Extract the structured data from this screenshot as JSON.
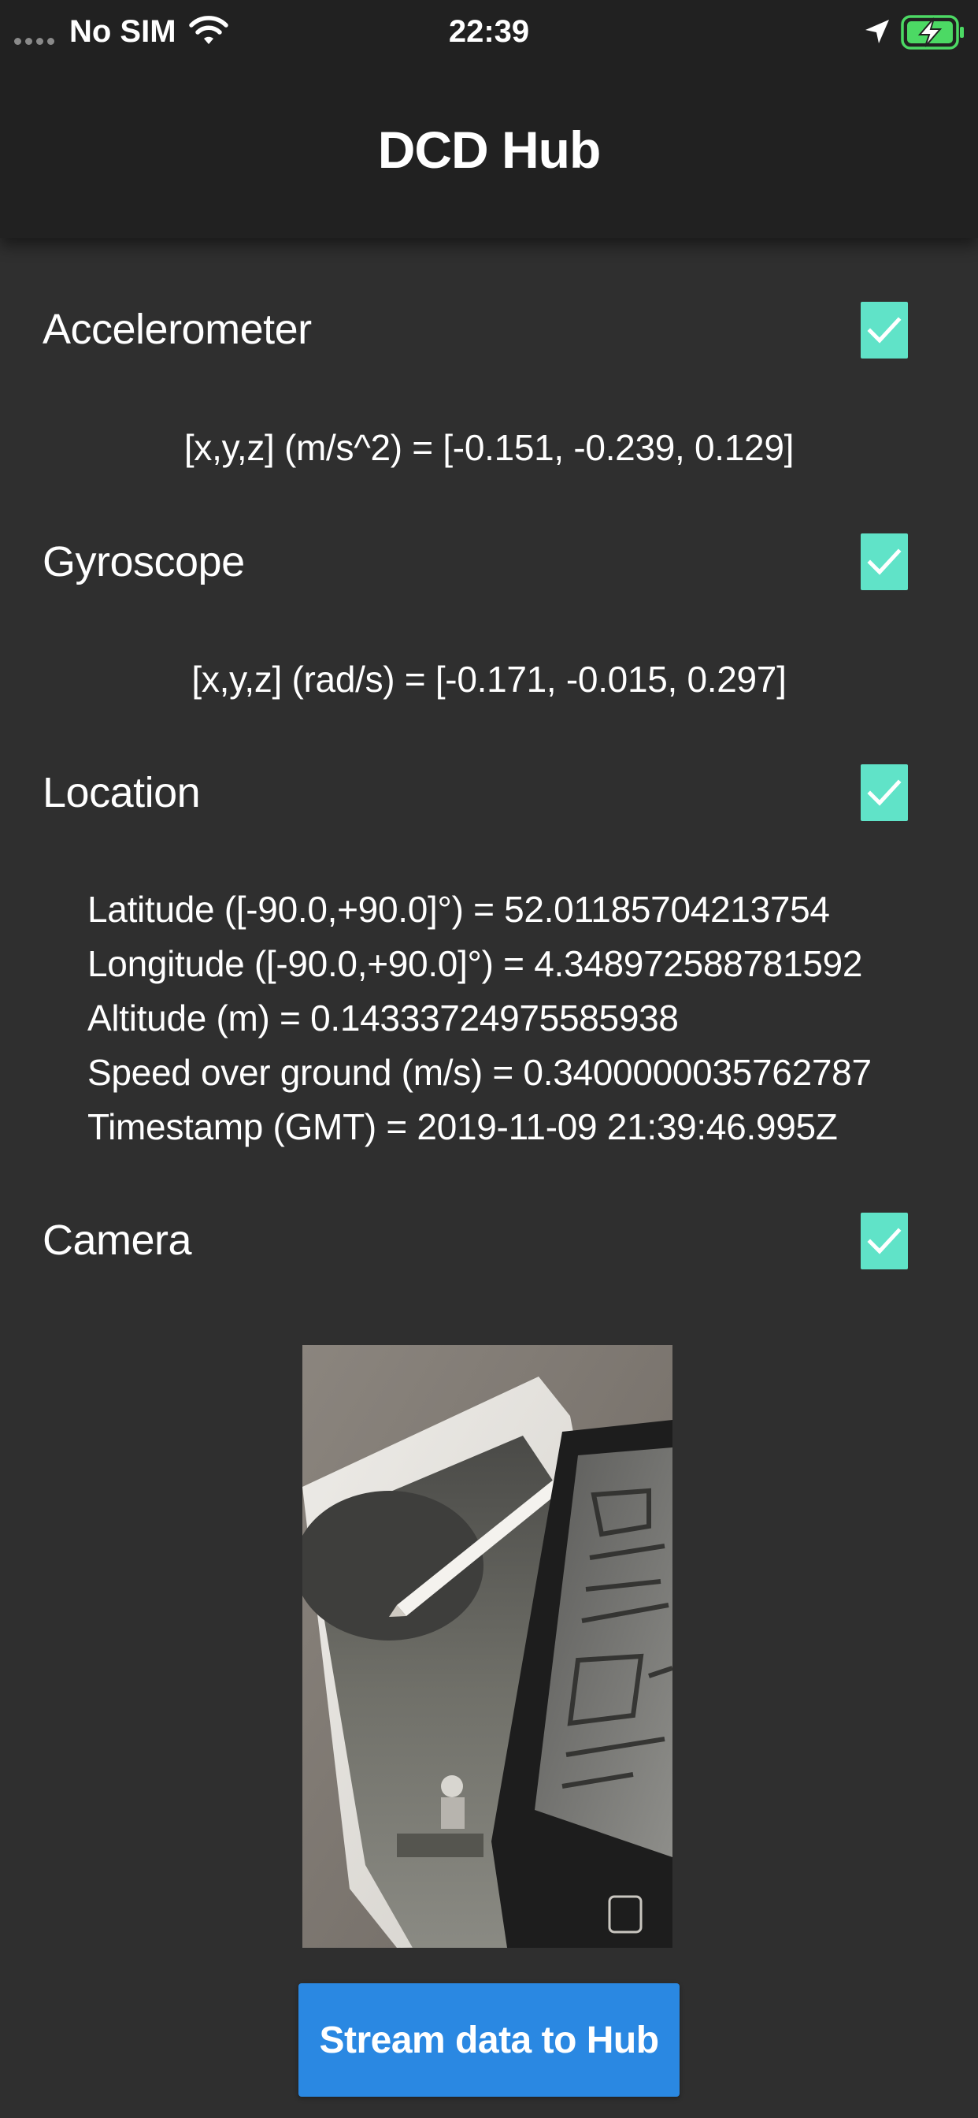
{
  "status_bar": {
    "carrier": "No SIM",
    "time": "22:39",
    "battery_color": "#4cd964"
  },
  "header": {
    "title": "DCD Hub"
  },
  "sensors": {
    "accelerometer": {
      "label": "Accelerometer",
      "checked": true,
      "reading": "[x,y,z] (m/s^2) = [-0.151, -0.239, 0.129]"
    },
    "gyroscope": {
      "label": "Gyroscope",
      "checked": true,
      "reading": "[x,y,z] (rad/s) = [-0.171, -0.015, 0.297]"
    },
    "location": {
      "label": "Location",
      "checked": true,
      "lines": [
        "Latitude ([-90.0,+90.0]°) = 52.01185704213754",
        "Longitude ([-90.0,+90.0]°) = 4.348972588781592",
        "Altitude (m) = 0.14333724975585938",
        "Speed over ground (m/s) = 0.3400000035762787",
        "Timestamp (GMT) = 2019-11-09 21:39:46.995Z"
      ]
    },
    "camera": {
      "label": "Camera",
      "checked": true
    }
  },
  "stream_button": {
    "label": "Stream data to Hub"
  },
  "colors": {
    "background": "#2f2f2f",
    "header": "#212121",
    "checkbox": "#60e3c8",
    "button": "#2a88e2"
  }
}
